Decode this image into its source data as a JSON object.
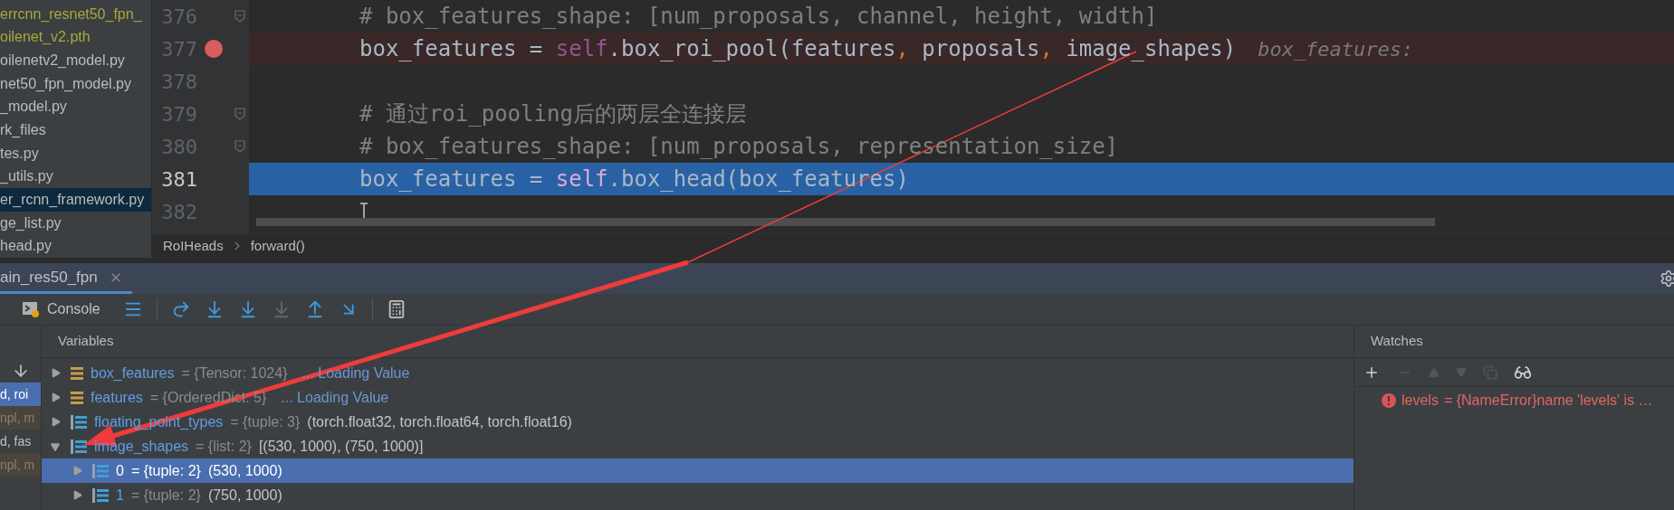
{
  "file_tree": {
    "items": [
      {
        "label": "errcnn_resnet50_fpn_",
        "kind": "untracked",
        "selected": false
      },
      {
        "label": "oilenet_v2.pth",
        "kind": "untracked",
        "selected": false
      },
      {
        "label": "oilenetv2_model.py",
        "kind": "normal",
        "selected": false
      },
      {
        "label": "net50_fpn_model.py",
        "kind": "normal",
        "selected": false
      },
      {
        "label": "_model.py",
        "kind": "normal",
        "selected": false
      },
      {
        "label": "rk_files",
        "kind": "normal",
        "selected": false
      },
      {
        "label": "tes.py",
        "kind": "normal",
        "selected": false
      },
      {
        "label": "_utils.py",
        "kind": "normal",
        "selected": false
      },
      {
        "label": "er_rcnn_framework.py",
        "kind": "normal",
        "selected": true
      },
      {
        "label": "ge_list.py",
        "kind": "normal",
        "selected": false
      },
      {
        "label": "head.py",
        "kind": "normal",
        "selected": false
      }
    ]
  },
  "editor": {
    "lines": [
      {
        "number": "376",
        "breakpoint": false,
        "current": false,
        "fold": true,
        "tokens": [
          {
            "text": "# box_features_shape: [num_proposals, channel, height, width]",
            "kind": "comment"
          }
        ]
      },
      {
        "number": "377",
        "breakpoint": true,
        "current": false,
        "fold": false,
        "hint": "box_features:",
        "tokens": [
          {
            "text": "box_features = ",
            "kind": "plain"
          },
          {
            "text": "self",
            "kind": "self"
          },
          {
            "text": ".box_roi_pool(features",
            "kind": "plain"
          },
          {
            "text": ",",
            "kind": "comma"
          },
          {
            "text": " proposals",
            "kind": "plain"
          },
          {
            "text": ",",
            "kind": "comma"
          },
          {
            "text": " image_shapes)",
            "kind": "plain"
          }
        ]
      },
      {
        "number": "378",
        "breakpoint": false,
        "current": false,
        "fold": false
      },
      {
        "number": "379",
        "breakpoint": false,
        "current": false,
        "fold": true,
        "tokens": [
          {
            "text": "# 通过roi_pooling后的两层全连接层",
            "kind": "comment"
          }
        ]
      },
      {
        "number": "380",
        "breakpoint": false,
        "current": false,
        "fold": true,
        "tokens": [
          {
            "text": "# box_features_shape: [num_proposals, representation_size]",
            "kind": "comment"
          }
        ]
      },
      {
        "number": "381",
        "breakpoint": false,
        "current": true,
        "fold": false,
        "tokens": [
          {
            "text": "box_features = ",
            "kind": "plain"
          },
          {
            "text": "self",
            "kind": "self"
          },
          {
            "text": ".box_head(box_features)",
            "kind": "plain"
          }
        ]
      },
      {
        "number": "382",
        "breakpoint": false,
        "current": false,
        "fold": false
      }
    ]
  },
  "breadcrumbs": [
    "RoIHeads",
    "forward()"
  ],
  "debug_tab": {
    "label": "ain_res50_fpn",
    "selected": true
  },
  "toolbar": {
    "console_label": "Console"
  },
  "frames": [
    {
      "label": "d, roi",
      "kind": "own",
      "selected": true
    },
    {
      "label": "npl, m",
      "kind": "library",
      "selected": false
    },
    {
      "label": "d, fas",
      "kind": "own",
      "selected": false
    },
    {
      "label": "npl, m",
      "kind": "library",
      "selected": false
    }
  ],
  "variables": {
    "title": "Variables",
    "items": [
      {
        "name": "box_features",
        "type": "= {Tensor: 1024}",
        "value": "... Loading Value",
        "kind": "pending",
        "expanded": false,
        "selected": false
      },
      {
        "name": "features",
        "type": "= {OrderedDict: 5}",
        "value": "... Loading Value",
        "kind": "pending",
        "expanded": false,
        "selected": false
      },
      {
        "name": "floating_point_types",
        "type": "= {tuple: 3}",
        "value": "(torch.float32, torch.float64, torch.float16)",
        "kind": "sequence",
        "expanded": false,
        "selected": false
      },
      {
        "name": "image_shapes",
        "type": "= {list: 2}",
        "value": "[(530, 1000), (750, 1000)]",
        "kind": "sequence",
        "expanded": true,
        "selected": false,
        "children": [
          {
            "name": "0",
            "type": "= {tuple: 2}",
            "value": "(530, 1000)",
            "kind": "sequence",
            "expanded": false,
            "selected": true
          },
          {
            "name": "1",
            "type": "= {tuple: 2}",
            "value": "(750, 1000)",
            "kind": "sequence",
            "expanded": false,
            "selected": false
          }
        ]
      }
    ]
  },
  "watches": {
    "title": "Watches",
    "items": [
      {
        "name": "levels",
        "value": "= {NameError}name 'levels' is …",
        "kind": "error"
      }
    ]
  }
}
